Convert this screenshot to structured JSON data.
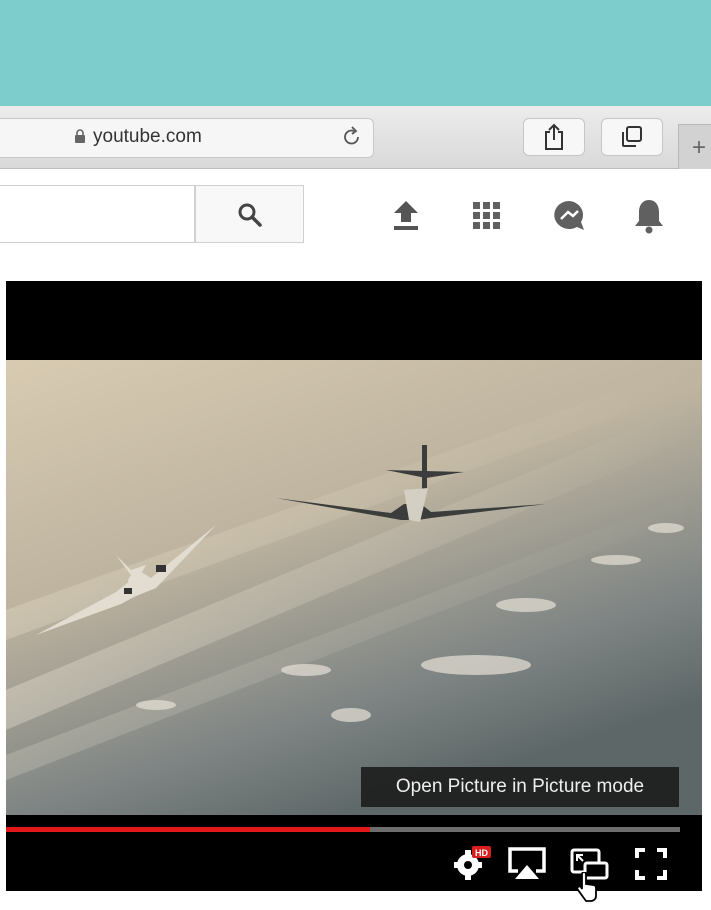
{
  "browser": {
    "url": "youtube.com"
  },
  "player": {
    "tooltip": "Open Picture in Picture mode",
    "progress_fraction": 0.54,
    "hd_badge": "HD"
  },
  "icons": {
    "toolbar": [
      "lock-icon",
      "reload-icon",
      "share-icon",
      "tabs-icon",
      "new-tab-plus"
    ],
    "header": [
      "search-icon",
      "upload-icon",
      "apps-grid-icon",
      "messages-icon",
      "notifications-bell-icon"
    ],
    "controls": [
      "settings-gear-icon",
      "airplay-icon",
      "picture-in-picture-icon",
      "fullscreen-icon"
    ]
  },
  "colors": {
    "desktop_bg": "#7ecdcd",
    "progress": "#e01818",
    "player_bg": "#000000"
  }
}
